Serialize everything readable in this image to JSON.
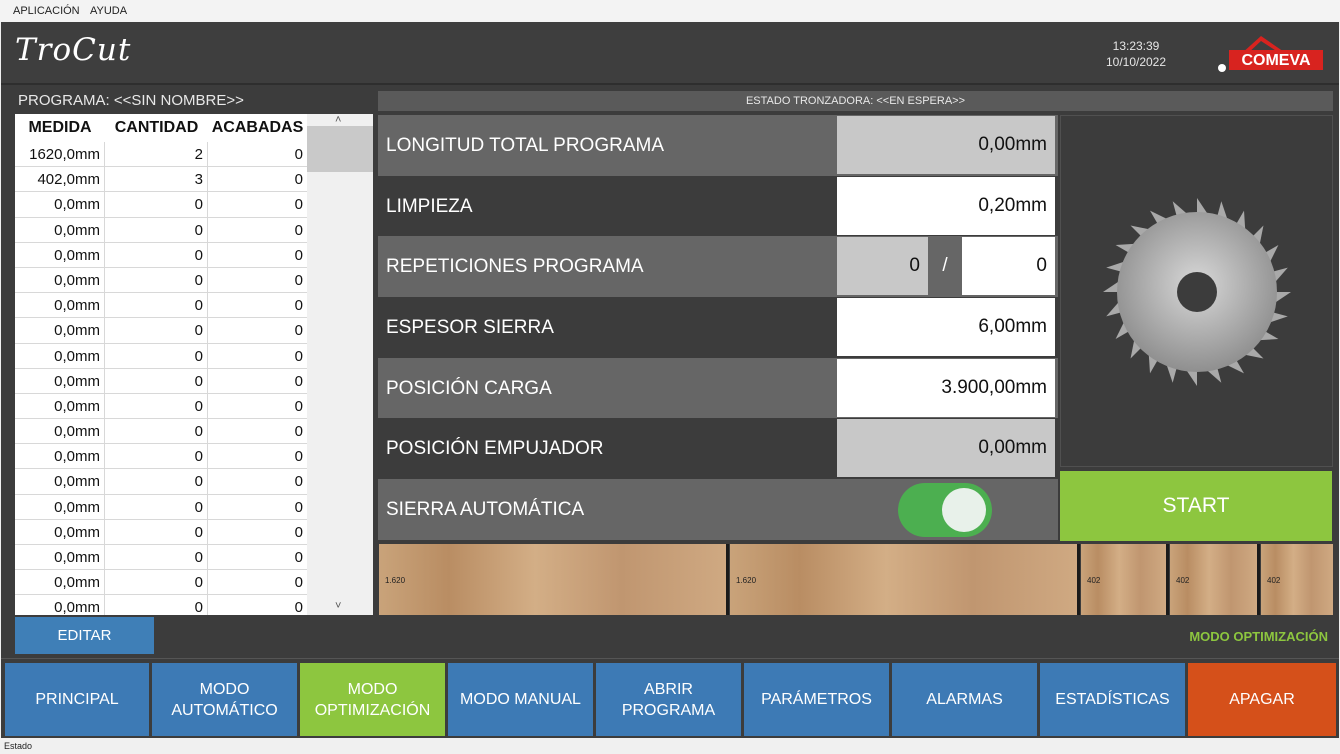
{
  "menu": {
    "app": "APLICACIÓN",
    "help": "AYUDA"
  },
  "header": {
    "title": "TroCut",
    "time": "13:23:39",
    "date": "10/10/2022",
    "brand": "COMEVA"
  },
  "program": {
    "label": "PROGRAMA: <<SIN NOMBRE>>"
  },
  "status": {
    "saw_state": "ESTADO TRONZADORA: <<EN ESPERA>>"
  },
  "table": {
    "headers": [
      "MEDIDA",
      "CANTIDAD",
      "ACABADAS"
    ],
    "rows": [
      [
        "1620,0mm",
        "2",
        "0"
      ],
      [
        "402,0mm",
        "3",
        "0"
      ],
      [
        "0,0mm",
        "0",
        "0"
      ],
      [
        "0,0mm",
        "0",
        "0"
      ],
      [
        "0,0mm",
        "0",
        "0"
      ],
      [
        "0,0mm",
        "0",
        "0"
      ],
      [
        "0,0mm",
        "0",
        "0"
      ],
      [
        "0,0mm",
        "0",
        "0"
      ],
      [
        "0,0mm",
        "0",
        "0"
      ],
      [
        "0,0mm",
        "0",
        "0"
      ],
      [
        "0,0mm",
        "0",
        "0"
      ],
      [
        "0,0mm",
        "0",
        "0"
      ],
      [
        "0,0mm",
        "0",
        "0"
      ],
      [
        "0,0mm",
        "0",
        "0"
      ],
      [
        "0,0mm",
        "0",
        "0"
      ],
      [
        "0,0mm",
        "0",
        "0"
      ],
      [
        "0,0mm",
        "0",
        "0"
      ],
      [
        "0,0mm",
        "0",
        "0"
      ],
      [
        "0,0mm",
        "0",
        "0"
      ]
    ]
  },
  "params": {
    "longitud_label": "LONGITUD TOTAL PROGRAMA",
    "longitud_value": "0,00mm",
    "limpieza_label": "LIMPIEZA",
    "limpieza_value": "0,20mm",
    "repeticiones_label": "REPETICIONES PROGRAMA",
    "repeticiones_done": "0",
    "repeticiones_sep": "/",
    "repeticiones_total": "0",
    "espesor_label": "ESPESOR SIERRA",
    "espesor_value": "6,00mm",
    "carga_label": "POSICIÓN CARGA",
    "carga_value": "3.900,00mm",
    "empujador_label": "POSICIÓN EMPUJADOR",
    "empujador_value": "0,00mm",
    "sierra_label": "SIERRA AUTOMÁTICA",
    "sierra_on": true
  },
  "start_label": "START",
  "pieces": [
    "1.620",
    "1.620",
    "402",
    "402",
    "402"
  ],
  "edit_label": "EDITAR",
  "mode_label": "MODO OPTIMIZACIÓN",
  "colors": {
    "accent_green": "#8dc63f",
    "nav_blue": "#3d7ab5",
    "power_red": "#d5501a"
  },
  "nav": {
    "principal": "PRINCIPAL",
    "auto": "MODO AUTOMÁTICO",
    "optim": "MODO OPTIMIZACIÓN",
    "manual": "MODO MANUAL",
    "abrir": "ABRIR PROGRAMA",
    "parametros": "PARÁMETROS",
    "alarmas": "ALARMAS",
    "estadisticas": "ESTADÍSTICAS",
    "apagar": "APAGAR"
  },
  "statusbar": "Estado"
}
